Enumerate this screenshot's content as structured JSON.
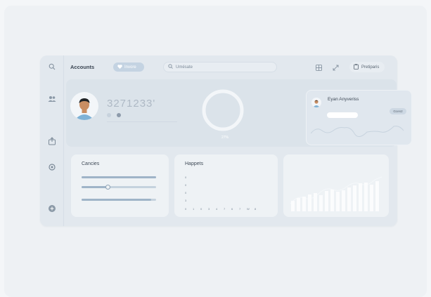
{
  "topbar": {
    "title": "Accounts",
    "pill_label": "Invore",
    "search_placeholder": "Umésate",
    "right_button_label": "Pretiparis"
  },
  "hero": {
    "amount": "3271233'",
    "meta_labels": [
      "",
      ""
    ],
    "ring_label": "27%",
    "ring_percent": 0
  },
  "profile": {
    "name": "Eyan Anyveriss",
    "subtitle": "",
    "badge": "Gcen2"
  },
  "cards": {
    "cancies_title": "Cancies",
    "cancies_sliders": [
      1.0,
      0.35,
      0.93
    ],
    "happets_title": "Happets",
    "happets_y_ticks": [
      "0",
      "0",
      "0",
      "3"
    ],
    "happets_x_ticks": [
      "0",
      "1",
      "0",
      "3",
      "4",
      "7",
      "6",
      "7",
      "W",
      "8"
    ]
  },
  "colors": {
    "accent": "#c4d3e2",
    "panel": "#e2e8ee",
    "card": "#eef2f5"
  }
}
